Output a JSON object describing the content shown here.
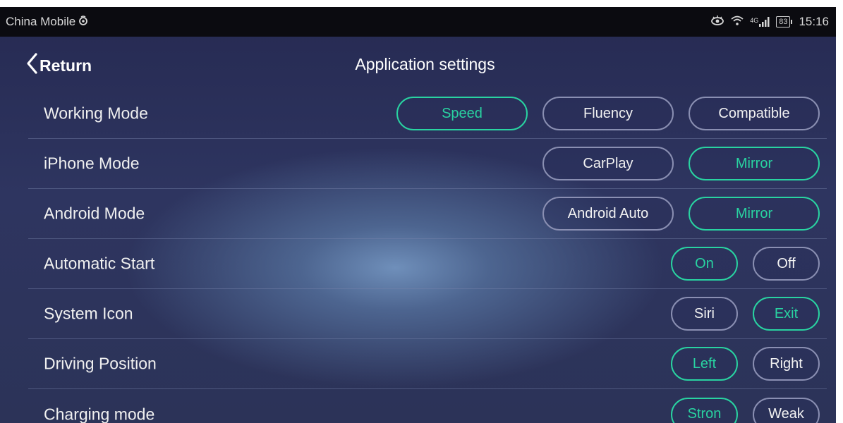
{
  "status_bar": {
    "carrier": "China Mobile",
    "network": "4G",
    "battery": "83",
    "time": "15:16"
  },
  "header": {
    "return_label": "Return",
    "title": "Application settings"
  },
  "settings": [
    {
      "label": "Working Mode",
      "options": [
        {
          "label": "Speed",
          "selected": true
        },
        {
          "label": "Fluency",
          "selected": false
        },
        {
          "label": "Compatible",
          "selected": false
        }
      ]
    },
    {
      "label": "iPhone Mode",
      "options": [
        {
          "label": "CarPlay",
          "selected": false
        },
        {
          "label": "Mirror",
          "selected": true
        }
      ]
    },
    {
      "label": "Android Mode",
      "options": [
        {
          "label": "Android Auto",
          "selected": false
        },
        {
          "label": "Mirror",
          "selected": true
        }
      ]
    },
    {
      "label": "Automatic Start",
      "options": [
        {
          "label": "On",
          "selected": true
        },
        {
          "label": "Off",
          "selected": false
        }
      ]
    },
    {
      "label": "System Icon",
      "options": [
        {
          "label": "Siri",
          "selected": false
        },
        {
          "label": "Exit",
          "selected": true
        }
      ]
    },
    {
      "label": "Driving Position",
      "options": [
        {
          "label": "Left",
          "selected": true
        },
        {
          "label": "Right",
          "selected": false
        }
      ]
    },
    {
      "label": "Charging mode",
      "options": [
        {
          "label": "Stron",
          "selected": true
        },
        {
          "label": "Weak",
          "selected": false
        }
      ]
    }
  ],
  "colors": {
    "accent": "#29d3a1",
    "button_border": "#8a8fb2",
    "background": "#2c3358",
    "status_bar": "#0b0b10"
  },
  "icons": [
    "eye-icon",
    "wifi-icon",
    "signal-icon",
    "battery-icon",
    "chevron-left-icon",
    "carrier-logo-icon"
  ]
}
